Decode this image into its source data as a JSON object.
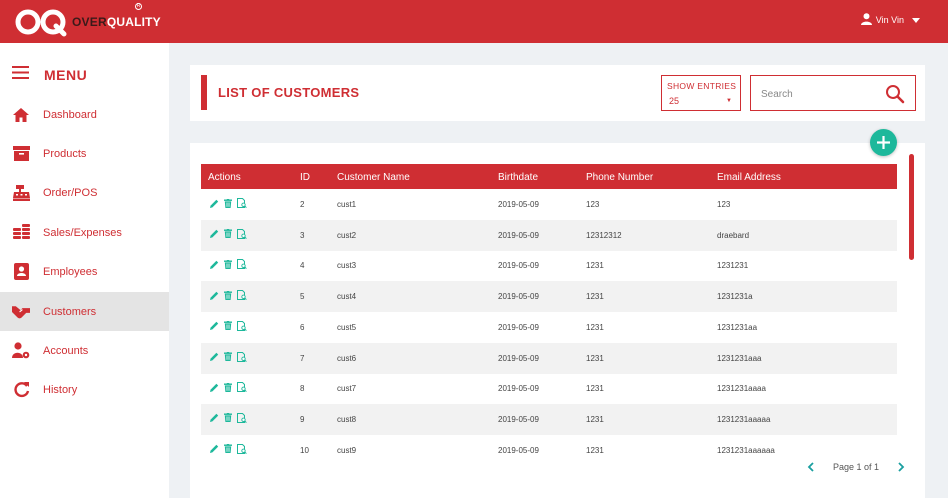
{
  "brand": {
    "name_light": "OVER",
    "name_bold": "QUALITY"
  },
  "user": {
    "name": "Vin Vin"
  },
  "menu": {
    "title": "MENU",
    "items": [
      {
        "label": "Dashboard",
        "icon": "home-icon"
      },
      {
        "label": "Products",
        "icon": "archive-box-icon"
      },
      {
        "label": "Order/POS",
        "icon": "cash-register-icon"
      },
      {
        "label": "Sales/Expenses",
        "icon": "coins-icon"
      },
      {
        "label": "Employees",
        "icon": "id-badge-icon"
      },
      {
        "label": "Customers",
        "icon": "handshake-icon",
        "active": true
      },
      {
        "label": "Accounts",
        "icon": "user-cog-icon"
      },
      {
        "label": "History",
        "icon": "refresh-icon"
      }
    ]
  },
  "header": {
    "title": "LIST OF CUSTOMERS",
    "entries_label": "SHOW ENTRIES",
    "entries_value": "25",
    "search_placeholder": "Search"
  },
  "table": {
    "columns": [
      "Actions",
      "ID",
      "Customer Name",
      "Birthdate",
      "Phone Number",
      "Email Address"
    ],
    "rows": [
      {
        "id": "2",
        "name": "cust1",
        "birthdate": "2019-05-09",
        "phone": "123",
        "email": "123"
      },
      {
        "id": "3",
        "name": "cust2",
        "birthdate": "2019-05-09",
        "phone": "12312312",
        "email": "draebard"
      },
      {
        "id": "4",
        "name": "cust3",
        "birthdate": "2019-05-09",
        "phone": "1231",
        "email": "1231231"
      },
      {
        "id": "5",
        "name": "cust4",
        "birthdate": "2019-05-09",
        "phone": "1231",
        "email": "1231231a"
      },
      {
        "id": "6",
        "name": "cust5",
        "birthdate": "2019-05-09",
        "phone": "1231",
        "email": "1231231aa"
      },
      {
        "id": "7",
        "name": "cust6",
        "birthdate": "2019-05-09",
        "phone": "1231",
        "email": "1231231aaa"
      },
      {
        "id": "8",
        "name": "cust7",
        "birthdate": "2019-05-09",
        "phone": "1231",
        "email": "1231231aaaa"
      },
      {
        "id": "9",
        "name": "cust8",
        "birthdate": "2019-05-09",
        "phone": "1231",
        "email": "1231231aaaaa"
      },
      {
        "id": "10",
        "name": "cust9",
        "birthdate": "2019-05-09",
        "phone": "1231",
        "email": "1231231aaaaaa"
      }
    ]
  },
  "pager": {
    "text": "Page 1 of 1"
  },
  "colors": {
    "brand_red": "#cf2e33",
    "accent_teal": "#1db89b"
  }
}
